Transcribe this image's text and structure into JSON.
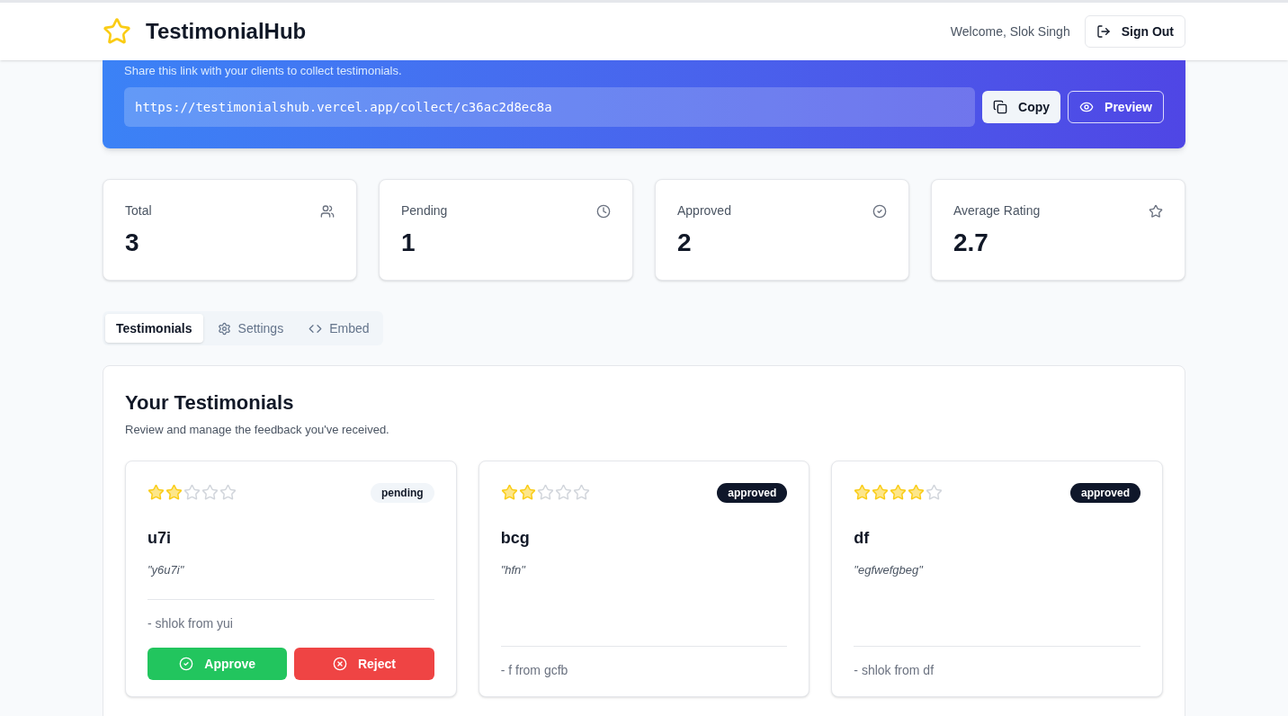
{
  "header": {
    "brand": "TestimonialHub",
    "welcome": "Welcome, Slok Singh",
    "sign_out": "Sign Out"
  },
  "banner": {
    "subtitle": "Share this link with your clients to collect testimonials.",
    "link": "https://testimonialshub.vercel.app/collect/c36ac2d8ec8a",
    "copy": "Copy",
    "preview": "Preview"
  },
  "stats": [
    {
      "kind": "users",
      "label": "Total",
      "value": "3"
    },
    {
      "kind": "clock",
      "label": "Pending",
      "value": "1"
    },
    {
      "kind": "check",
      "label": "Approved",
      "value": "2"
    },
    {
      "kind": "star",
      "label": "Average Rating",
      "value": "2.7"
    }
  ],
  "tabs": [
    {
      "kind": "none",
      "label": "Testimonials",
      "selected": true
    },
    {
      "kind": "gear",
      "label": "Settings",
      "selected": false
    },
    {
      "kind": "code",
      "label": "Embed",
      "selected": false
    }
  ],
  "panel": {
    "title": "Your Testimonials",
    "subtitle": "Review and manage the feedback you've received."
  },
  "testimonials": [
    {
      "stars": 2,
      "status": "pending",
      "approved": false,
      "title": "u7i",
      "quote": "\"y6u7i\"",
      "author": "- shlok from yui",
      "actions": [
        {
          "kind": "approve",
          "label": "Approve"
        },
        {
          "kind": "reject",
          "label": "Reject"
        }
      ]
    },
    {
      "stars": 2,
      "status": "approved",
      "approved": true,
      "title": "bcg",
      "quote": "\"hfn\"",
      "author": "- f from gcfb"
    },
    {
      "stars": 4,
      "status": "approved",
      "approved": true,
      "title": "df",
      "quote": "\"egfwefgbeg\"",
      "author": "- shlok from df"
    }
  ]
}
